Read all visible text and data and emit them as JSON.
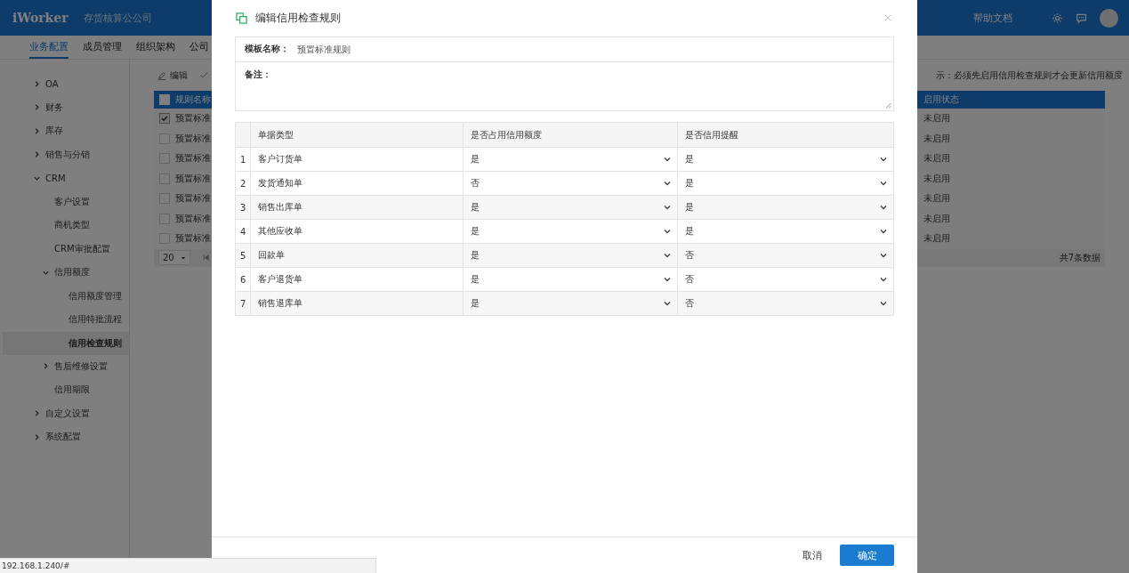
{
  "app_header": {
    "logo": "iWorker",
    "company": "存货核算公公司",
    "help_link": "帮助文档"
  },
  "nav_tabs": [
    {
      "label": "业务配置",
      "selected": true
    },
    {
      "label": "成员管理",
      "selected": false
    },
    {
      "label": "组织架构",
      "selected": false
    },
    {
      "label": "公司",
      "selected": false
    }
  ],
  "sidebar": {
    "items": [
      {
        "label": "OA",
        "expanded": false,
        "selected": false
      },
      {
        "label": "财务",
        "expanded": false,
        "selected": false
      },
      {
        "label": "库存",
        "expanded": false,
        "selected": false
      },
      {
        "label": "销售与分销",
        "expanded": false,
        "selected": false
      },
      {
        "label": "CRM",
        "expanded": true,
        "selected": false,
        "children": [
          {
            "label": "客户设置",
            "selected": false
          },
          {
            "label": "商机类型",
            "selected": false
          },
          {
            "label": "CRM审批配置",
            "selected": false
          },
          {
            "label": "信用额度",
            "expanded": true,
            "selected": false,
            "children": [
              {
                "label": "信用额度管理",
                "selected": false
              },
              {
                "label": "信用特批流程",
                "selected": false
              },
              {
                "label": "信用检查规则",
                "selected": true
              }
            ]
          },
          {
            "label": "售后维修设置",
            "expanded": false,
            "selected": false
          },
          {
            "label": "信用期限",
            "selected": false
          }
        ]
      },
      {
        "label": "自定义设置",
        "expanded": false,
        "selected": false
      },
      {
        "label": "系统配置",
        "expanded": false,
        "selected": false
      }
    ]
  },
  "toolbar": {
    "edit_label": "编辑",
    "hint": "示：必须先启用信用检查规则才会更新信用额度"
  },
  "rule_table": {
    "header_checked": false,
    "columns": [
      "规则名称",
      "启用状态"
    ],
    "rows": [
      {
        "checked": true,
        "name": "预置标准",
        "status": "未启用"
      },
      {
        "checked": false,
        "name": "预置标准",
        "status": "未启用"
      },
      {
        "checked": false,
        "name": "预置标准",
        "status": "未启用"
      },
      {
        "checked": false,
        "name": "预置标准",
        "status": "未启用"
      },
      {
        "checked": false,
        "name": "预置标准",
        "status": "未启用"
      },
      {
        "checked": false,
        "name": "预置标准",
        "status": "未启用"
      },
      {
        "checked": false,
        "name": "预置标准",
        "status": "未启用"
      }
    ],
    "page_size": "20",
    "total": "共7条数据"
  },
  "dialog": {
    "title": "编辑信用检查规则",
    "template_label": "模板名称：",
    "template_value": "预置标准规则",
    "remark_label": "备注：",
    "grid": {
      "columns": [
        "单据类型",
        "是否占用信用额度",
        "是否信用提醒"
      ],
      "rows": [
        {
          "index": "1",
          "doc_type": "客户订货单",
          "occupies_credit": "是",
          "credit_reminder": "是"
        },
        {
          "index": "2",
          "doc_type": "发货通知单",
          "occupies_credit": "否",
          "credit_reminder": "是"
        },
        {
          "index": "3",
          "doc_type": "销售出库单",
          "occupies_credit": "是",
          "credit_reminder": "是"
        },
        {
          "index": "4",
          "doc_type": "其他应收单",
          "occupies_credit": "是",
          "credit_reminder": "是"
        },
        {
          "index": "5",
          "doc_type": "回款单",
          "occupies_credit": "是",
          "credit_reminder": "否"
        },
        {
          "index": "6",
          "doc_type": "客户退货单",
          "occupies_credit": "是",
          "credit_reminder": "否"
        },
        {
          "index": "7",
          "doc_type": "销售退库单",
          "occupies_credit": "是",
          "credit_reminder": "否"
        }
      ]
    },
    "buttons": [
      {
        "label": "取消",
        "kind": "secondary"
      },
      {
        "label": "确定",
        "kind": "primary"
      }
    ]
  },
  "status_bar": {
    "url": "192.168.1.240/#"
  }
}
